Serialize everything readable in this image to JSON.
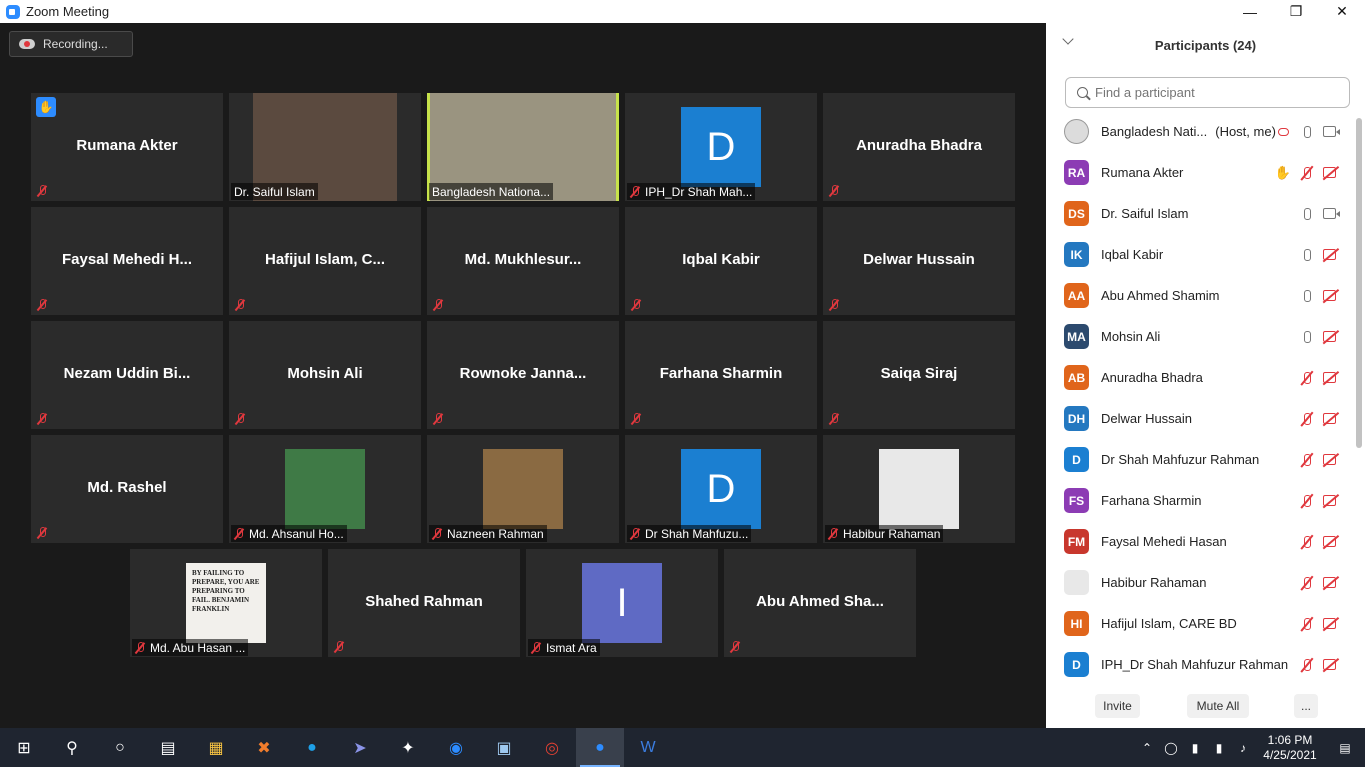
{
  "window": {
    "title": "Zoom Meeting"
  },
  "recording": {
    "label": "Recording..."
  },
  "tiles": [
    {
      "name": "Rumana Akter",
      "kind": "name",
      "hand": true
    },
    {
      "name": "Dr. Saiful Islam",
      "kind": "video",
      "color": "#5b4a3f"
    },
    {
      "name": "Bangladesh Nationa...",
      "kind": "video",
      "color": "#9a9480",
      "active": true
    },
    {
      "name": "IPH_Dr Shah Mah...",
      "kind": "letter",
      "letter": "D",
      "color": "#1b7fd1"
    },
    {
      "name": "Anuradha Bhadra",
      "kind": "name"
    },
    {
      "name": "Faysal  Mehedi  H...",
      "kind": "name"
    },
    {
      "name": "Hafijul  Islam,  C...",
      "kind": "name"
    },
    {
      "name": "Md.  Mukhlesur...",
      "kind": "name"
    },
    {
      "name": "Iqbal Kabir",
      "kind": "name"
    },
    {
      "name": "Delwar Hussain",
      "kind": "name"
    },
    {
      "name": "Nezam  Uddin  Bi...",
      "kind": "name"
    },
    {
      "name": "Mohsin Ali",
      "kind": "name"
    },
    {
      "name": "Rownoke  Janna...",
      "kind": "name"
    },
    {
      "name": "Farhana Sharmin",
      "kind": "name"
    },
    {
      "name": "Saiqa Siraj",
      "kind": "name"
    },
    {
      "name": "Md. Rashel",
      "kind": "name"
    },
    {
      "name": "Md. Ahsanul Ho...",
      "kind": "photo",
      "color": "#3f7a46"
    },
    {
      "name": "Nazneen Rahman",
      "kind": "photo",
      "color": "#8a6a42"
    },
    {
      "name": "Dr Shah Mahfuzu...",
      "kind": "letter",
      "letter": "D",
      "color": "#1b7fd1"
    },
    {
      "name": "Habibur Rahaman",
      "kind": "photo",
      "color": "#e8e8e8"
    },
    {
      "name": "Md. Abu Hasan ...",
      "kind": "photo",
      "color": "#f2f0ec",
      "quote": "BY FAILING TO PREPARE, YOU ARE PREPARING TO FAIL. BENJAMIN FRANKLIN"
    },
    {
      "name": "Shahed Rahman",
      "kind": "name"
    },
    {
      "name": "Ismat Ara",
      "kind": "letter",
      "letter": "I",
      "color": "#5f6ac4"
    },
    {
      "name": "Abu  Ahmed  Sha...",
      "kind": "name"
    }
  ],
  "panel": {
    "title": "Participants (24)",
    "search_placeholder": "Find a participant",
    "participants": [
      {
        "initials": "",
        "name": "Bangladesh Nati...",
        "role": "(Host, me)",
        "color": "#dcdcdc",
        "mic": "rec",
        "cam": "on",
        "logo": true
      },
      {
        "initials": "RA",
        "name": "Rumana Akter",
        "color": "#8c3cb4",
        "mic": "off",
        "cam": "off",
        "hand": true
      },
      {
        "initials": "DS",
        "name": "Dr. Saiful Islam",
        "color": "#e0651b",
        "mic": "on",
        "cam": "on"
      },
      {
        "initials": "IK",
        "name": "Iqbal Kabir",
        "color": "#2478c0",
        "mic": "on",
        "cam": "off"
      },
      {
        "initials": "AA",
        "name": "Abu Ahmed Shamim",
        "color": "#e0651b",
        "mic": "on",
        "cam": "off"
      },
      {
        "initials": "MA",
        "name": "Mohsin Ali",
        "color": "#2c4a6e",
        "mic": "on",
        "cam": "off"
      },
      {
        "initials": "AB",
        "name": "Anuradha Bhadra",
        "color": "#e0651b",
        "mic": "off",
        "cam": "off"
      },
      {
        "initials": "DH",
        "name": "Delwar Hussain",
        "color": "#2478c0",
        "mic": "off",
        "cam": "off"
      },
      {
        "initials": "D",
        "name": "Dr Shah Mahfuzur Rahman",
        "color": "#1b7fd1",
        "mic": "off",
        "cam": "off"
      },
      {
        "initials": "FS",
        "name": "Farhana Sharmin",
        "color": "#8c3cb4",
        "mic": "off",
        "cam": "off"
      },
      {
        "initials": "FM",
        "name": "Faysal Mehedi Hasan",
        "color": "#c8372d",
        "mic": "off",
        "cam": "off"
      },
      {
        "initials": "",
        "name": "Habibur Rahaman",
        "color": "#e8e8e8",
        "mic": "off",
        "cam": "off",
        "photo": true
      },
      {
        "initials": "HI",
        "name": "Hafijul Islam, CARE BD",
        "color": "#e0651b",
        "mic": "off",
        "cam": "off"
      },
      {
        "initials": "D",
        "name": "IPH_Dr Shah Mahfuzur Rahman",
        "color": "#1b7fd1",
        "mic": "off",
        "cam": "off"
      }
    ],
    "invite_label": "Invite",
    "mute_all_label": "Mute All",
    "more_label": "..."
  },
  "taskbar": {
    "time": "1:06 PM",
    "date": "4/25/2021"
  }
}
